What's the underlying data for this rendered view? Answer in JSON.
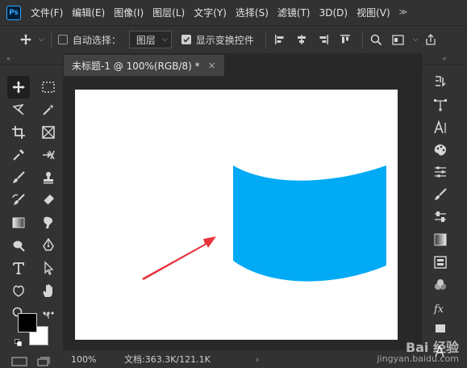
{
  "app": {
    "logo_text": "Ps"
  },
  "menu": [
    "文件(F)",
    "编辑(E)",
    "图像(I)",
    "图层(L)",
    "文字(Y)",
    "选择(S)",
    "滤镜(T)",
    "3D(D)",
    "视图(V)"
  ],
  "options": {
    "auto_select_label": "自动选择：",
    "auto_select_checked": false,
    "auto_select_target": "图层",
    "show_transform_label": "显示变换控件",
    "show_transform_checked": true
  },
  "document": {
    "tab_title": "未标题-1 @ 100%(RGB/8) *",
    "tab_close": "×",
    "zoom": "100%",
    "doc_info": "文档:363.3K/121.1K",
    "status_arrow": "›"
  },
  "canvas": {
    "background": "#ffffff",
    "shape_color": "#00aaf5",
    "arrow_color": "#e8323c"
  },
  "colors": {
    "foreground": "#000000",
    "background": "#ffffff"
  },
  "watermark": {
    "brand": "Bai 经验",
    "url": "jingyan.baidu.com"
  },
  "icons": {
    "left_tools": [
      "move-tool-icon",
      "marquee-tool-icon",
      "lasso-tool-icon",
      "magic-wand-tool-icon",
      "crop-tool-icon",
      "frame-tool-icon",
      "eyedropper-tool-icon",
      "measure-tool-icon",
      "brush-tool-icon",
      "stamp-tool-icon",
      "history-brush-tool-icon",
      "eraser-tool-icon",
      "gradient-tool-icon",
      "smudge-tool-icon",
      "dodge-tool-icon",
      "pen-tool-icon",
      "type-tool-icon",
      "path-selection-tool-icon",
      "custom-shape-tool-icon",
      "hand-tool-icon",
      "zoom-tool-icon",
      "more-tools-icon"
    ],
    "right_panels": [
      "history-panel-icon",
      "paths-panel-icon",
      "character-panel-icon",
      "swatches-panel-icon",
      "properties-panel-icon",
      "brushes-panel-icon",
      "adjustments-panel-icon",
      "gradients-panel-icon",
      "layers-panel-icon",
      "channels-panel-icon",
      "styles-panel-icon",
      "glyphs-panel-icon"
    ]
  }
}
